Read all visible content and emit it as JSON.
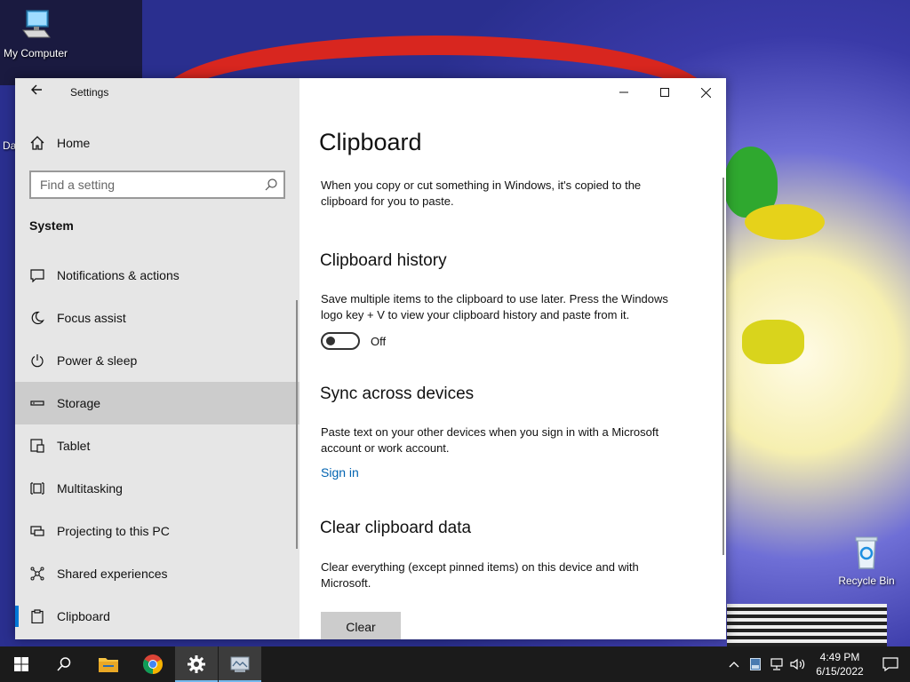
{
  "desktop": {
    "icons": [
      {
        "label": "My Computer"
      },
      {
        "label": "Recycle Bin"
      }
    ],
    "partial_label": "Da"
  },
  "window": {
    "app_title": "Settings",
    "controls": {
      "minimize": "minimize",
      "maximize": "maximize",
      "close": "close"
    }
  },
  "sidebar": {
    "home_label": "Home",
    "search_placeholder": "Find a setting",
    "section": "System",
    "items": [
      {
        "label": "Notifications & actions",
        "icon": "notification-icon"
      },
      {
        "label": "Focus assist",
        "icon": "moon-icon"
      },
      {
        "label": "Power & sleep",
        "icon": "power-icon"
      },
      {
        "label": "Storage",
        "icon": "storage-icon",
        "hover": true
      },
      {
        "label": "Tablet",
        "icon": "tablet-icon"
      },
      {
        "label": "Multitasking",
        "icon": "multitasking-icon"
      },
      {
        "label": "Projecting to this PC",
        "icon": "projecting-icon"
      },
      {
        "label": "Shared experiences",
        "icon": "shared-icon"
      },
      {
        "label": "Clipboard",
        "icon": "clipboard-icon",
        "selected": true
      }
    ]
  },
  "main": {
    "title": "Clipboard",
    "intro_line1": "When you copy or cut something in Windows, it's copied to the",
    "intro_line2": "clipboard for you to paste.",
    "history": {
      "heading": "Clipboard history",
      "desc_line1": "Save multiple items to the clipboard to use later. Press the Windows",
      "desc_line2": "logo key + V to view your clipboard history and paste from it.",
      "toggle_state": "Off"
    },
    "sync": {
      "heading": "Sync across devices",
      "desc_line1": "Paste text on your other devices when you sign in with a Microsoft",
      "desc_line2": "account or work account.",
      "link": "Sign in"
    },
    "clear": {
      "heading": "Clear clipboard data",
      "desc_line1": "Clear everything (except pinned items) on this device and with",
      "desc_line2": "Microsoft.",
      "button": "Clear"
    }
  },
  "taskbar": {
    "apps": [
      "start-icon",
      "search-icon",
      "file-explorer-icon",
      "chrome-icon",
      "settings-icon",
      "app-icon"
    ],
    "active": "settings-icon",
    "time": "4:49 PM",
    "date": "6/15/2022"
  },
  "colors": {
    "accent": "#0078d7",
    "link": "#0063b1",
    "sidebar_bg": "#e6e6e6",
    "taskbar_bg": "#1b1b1b"
  }
}
